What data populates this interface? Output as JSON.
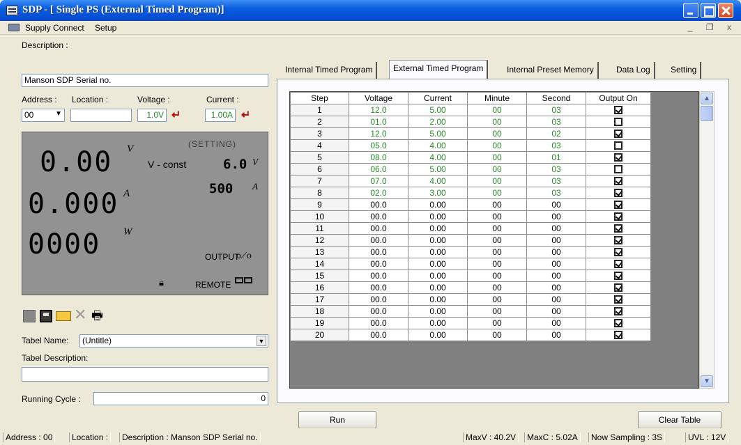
{
  "window": {
    "title": "SDP - [ Single PS (External Timed Program)]"
  },
  "menu": {
    "items": [
      "Supply Connect",
      "Setup"
    ],
    "mdi_controls": "_ ❒ x"
  },
  "left": {
    "description_label": "Description :",
    "description_value": "Manson SDP Serial no.",
    "address_label": "Address :",
    "address_value": "00",
    "location_label": "Location :",
    "location_value": "",
    "voltage_label": "Voltage :",
    "voltage_value": "1.0V",
    "current_label": "Current :",
    "current_value": "1.00A"
  },
  "lcd": {
    "voltage": "0.00",
    "voltage_unit": "V",
    "current": "0.000",
    "current_unit": "A",
    "power": "0000",
    "power_unit": "W",
    "setting_label": "(SETTING)",
    "mode": "V - const",
    "set_voltage": "6.0",
    "set_voltage_unit": "V",
    "set_current": "500",
    "set_current_unit": "A",
    "output_label": "OUTPUT",
    "remote_label": "REMOTE"
  },
  "table_form": {
    "name_label": "Tabel Name:",
    "name_value": "(Untitle)",
    "description_label": "Tabel Description:",
    "description_value": "",
    "running_cycle_label": "Running Cycle :",
    "running_cycle_value": "0"
  },
  "tabs": [
    "Internal Timed Program",
    "External Timed Program",
    "Internal Preset Memory",
    "Data Log",
    "Setting"
  ],
  "active_tab": "External Timed Program",
  "grid": {
    "headers": [
      "Step",
      "Voltage",
      "Current",
      "Minute",
      "Second",
      "Output On"
    ],
    "rows": [
      [
        "1",
        "12.0",
        "5.00",
        "00",
        "03",
        true
      ],
      [
        "2",
        "01.0",
        "2.00",
        "00",
        "03",
        false
      ],
      [
        "3",
        "12.0",
        "5.00",
        "00",
        "02",
        true
      ],
      [
        "4",
        "05.0",
        "4.00",
        "00",
        "03",
        false
      ],
      [
        "5",
        "08.0",
        "4.00",
        "00",
        "01",
        true
      ],
      [
        "6",
        "06.0",
        "5.00",
        "00",
        "03",
        false
      ],
      [
        "7",
        "07.0",
        "4.00",
        "00",
        "03",
        true
      ],
      [
        "8",
        "02.0",
        "3.00",
        "00",
        "03",
        true
      ],
      [
        "9",
        "00.0",
        "0.00",
        "00",
        "00",
        true
      ],
      [
        "10",
        "00.0",
        "0.00",
        "00",
        "00",
        true
      ],
      [
        "11",
        "00.0",
        "0.00",
        "00",
        "00",
        true
      ],
      [
        "12",
        "00.0",
        "0.00",
        "00",
        "00",
        true
      ],
      [
        "13",
        "00.0",
        "0.00",
        "00",
        "00",
        true
      ],
      [
        "14",
        "00.0",
        "0.00",
        "00",
        "00",
        true
      ],
      [
        "15",
        "00.0",
        "0.00",
        "00",
        "00",
        true
      ],
      [
        "16",
        "00.0",
        "0.00",
        "00",
        "00",
        true
      ],
      [
        "17",
        "00.0",
        "0.00",
        "00",
        "00",
        true
      ],
      [
        "18",
        "00.0",
        "0.00",
        "00",
        "00",
        true
      ],
      [
        "19",
        "00.0",
        "0.00",
        "00",
        "00",
        true
      ],
      [
        "20",
        "00.0",
        "0.00",
        "00",
        "00",
        true
      ]
    ],
    "active_steps": 8
  },
  "buttons": {
    "run": "Run",
    "clear_table": "Clear Table"
  },
  "status": {
    "address": "Address : 00",
    "location": "Location :",
    "description": "Description : Manson SDP Serial no.",
    "maxv": "MaxV : 40.2V",
    "maxc": "MaxC : 5.02A",
    "sampling": "Now Sampling : 3S",
    "uvl": "UVL : 12V"
  },
  "colors": {
    "titlebar": "#0a5ee0",
    "value_green": "#2a8a2a",
    "enter_arrow": "#b3140c",
    "lcd_bg": "#929292"
  }
}
